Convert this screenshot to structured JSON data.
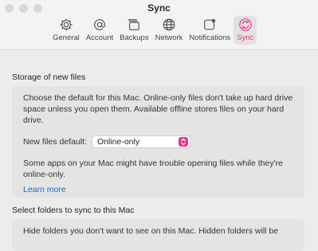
{
  "window": {
    "title": "Sync"
  },
  "tabs": [
    {
      "label": "General",
      "icon": "gear-icon"
    },
    {
      "label": "Account",
      "icon": "at-sign-icon"
    },
    {
      "label": "Backups",
      "icon": "backups-icon"
    },
    {
      "label": "Network",
      "icon": "globe-icon"
    },
    {
      "label": "Notifications",
      "icon": "notification-icon"
    },
    {
      "label": "Sync",
      "icon": "sync-icon",
      "active": true
    }
  ],
  "storage": {
    "heading": "Storage of new files",
    "description": "Choose the default for this Mac. Online-only files don't take up hard drive space unless you open them. Available offline stores files on your hard drive.",
    "default_label": "New files default:",
    "default_value": "Online-only",
    "note": "Some apps on your Mac might have trouble opening files while they're online-only.",
    "learn_more": "Learn more"
  },
  "folders": {
    "heading": "Select folders to sync to this Mac",
    "description": "Hide folders you don't want to see on this Mac. Hidden folders will be"
  },
  "colors": {
    "accent": "#e8358a",
    "link": "#1a66c9"
  }
}
